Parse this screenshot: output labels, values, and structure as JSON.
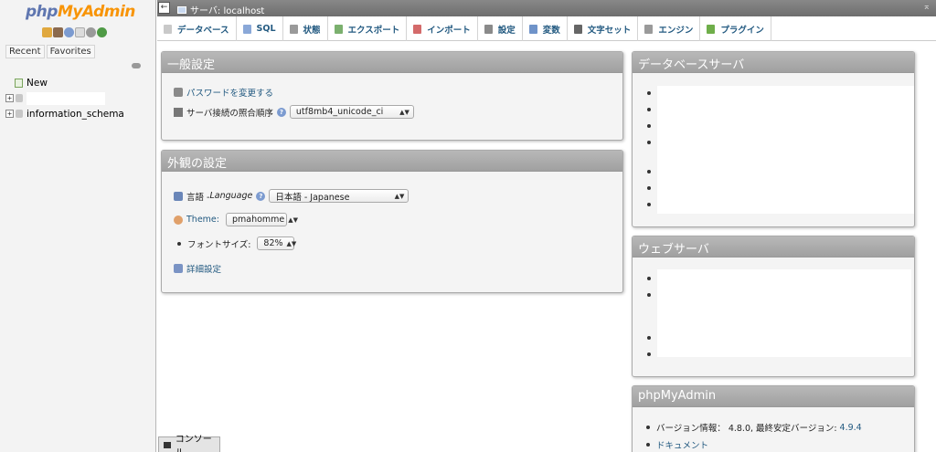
{
  "nav": {
    "logo_php": "php",
    "logo_myadmin": "MyAdmin",
    "tabs": [
      "Recent",
      "Favorites"
    ],
    "tree": [
      {
        "label": "New"
      },
      {
        "label": ""
      },
      {
        "label": "information_schema"
      }
    ],
    "icons": [
      "home-icon",
      "sql-icon",
      "help-icon",
      "docs-icon",
      "settings-icon",
      "reload-icon"
    ]
  },
  "topbar": {
    "back_symbol": "←",
    "server_label": "サーバ: localhost",
    "collapse_symbol": "⌅"
  },
  "menu": [
    {
      "label": "データベース",
      "icon": "database-icon",
      "color": "#c9c9c9"
    },
    {
      "label": "SQL",
      "icon": "sql-icon",
      "color": "#8aa8d8"
    },
    {
      "label": "状態",
      "icon": "status-icon",
      "color": "#9a9a9a"
    },
    {
      "label": "エクスポート",
      "icon": "export-icon",
      "color": "#7bb06e"
    },
    {
      "label": "インポート",
      "icon": "import-icon",
      "color": "#d46a6a"
    },
    {
      "label": "設定",
      "icon": "wrench-icon",
      "color": "#8a8a8a"
    },
    {
      "label": "変数",
      "icon": "variables-icon",
      "color": "#6f93c9"
    },
    {
      "label": "文字セット",
      "icon": "charset-icon",
      "color": "#666666"
    },
    {
      "label": "エンジン",
      "icon": "engine-icon",
      "color": "#9a9a9a"
    },
    {
      "label": "プラグイン",
      "icon": "plugin-icon",
      "color": "#6fae4a"
    }
  ],
  "general": {
    "title": "一般設定",
    "change_password": "パスワードを変更する",
    "collation_label": "サーバ接続の照合順序",
    "collation_value": "utf8mb4_unicode_ci"
  },
  "appearance": {
    "title": "外観の設定",
    "language_label": "言語 - ",
    "language_label_en": "Language",
    "language_value": "日本語 - Japanese",
    "theme_label": "Theme:",
    "theme_value": "pmahomme",
    "font_size_label": "フォントサイズ:",
    "font_size_value": "82%",
    "more_settings": "詳細設定"
  },
  "db_server": {
    "title": "データベースサーバ"
  },
  "web_server": {
    "title": "ウェブサーバ"
  },
  "pma": {
    "title": "phpMyAdmin",
    "version_label": "バージョン情報：",
    "version_value": "4.8.0, 最終安定バージョン:",
    "latest_version": "4.9.4",
    "documentation": "ドキュメント"
  },
  "console": {
    "label": "コンソール"
  }
}
